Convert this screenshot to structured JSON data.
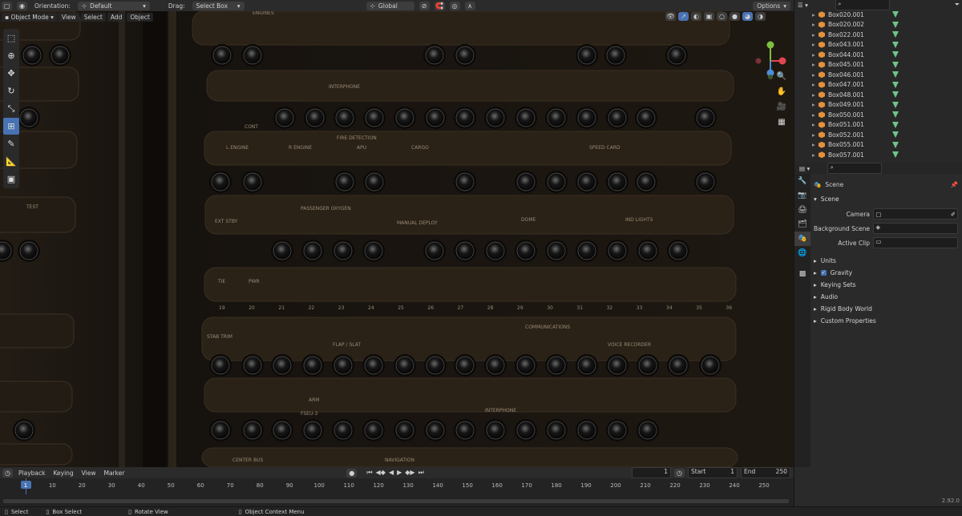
{
  "header": {
    "mode_label": "Object Mode",
    "menus": [
      "View",
      "Select",
      "Add",
      "Object"
    ],
    "orientation_label": "Orientation:",
    "orientation_value": "Default",
    "drag_label": "Drag:",
    "drag_value": "Select Box",
    "transform_value": "Global",
    "options_label": "Options"
  },
  "outliner": {
    "items": [
      "Box020.001",
      "Box020.002",
      "Box022.001",
      "Box043.001",
      "Box044.001",
      "Box045.001",
      "Box046.001",
      "Box047.001",
      "Box048.001",
      "Box049.001",
      "Box050.001",
      "Box051.001",
      "Box052.001",
      "Box055.001",
      "Box057.001"
    ]
  },
  "properties": {
    "title": "Scene",
    "panel_title": "Scene",
    "camera_label": "Camera",
    "background_label": "Background Scene",
    "clip_label": "Active Clip",
    "sections": [
      {
        "label": "Units",
        "checkbox": false
      },
      {
        "label": "Gravity",
        "checkbox": true
      },
      {
        "label": "Keying Sets",
        "checkbox": false
      },
      {
        "label": "Audio",
        "checkbox": false
      },
      {
        "label": "Rigid Body World",
        "checkbox": false
      },
      {
        "label": "Custom Properties",
        "checkbox": false
      }
    ],
    "version": "2.92.0"
  },
  "timeline": {
    "menus": [
      "Playback",
      "Keying",
      "View",
      "Marker"
    ],
    "current_frame": "1",
    "start_label": "Start",
    "start_value": "1",
    "end_label": "End",
    "end_value": "250",
    "frames": [
      "1",
      "10",
      "20",
      "30",
      "40",
      "50",
      "60",
      "70",
      "80",
      "90",
      "100",
      "110",
      "120",
      "130",
      "140",
      "150",
      "160",
      "170",
      "180",
      "190",
      "200",
      "210",
      "220",
      "230",
      "240",
      "250"
    ]
  },
  "status_bar": {
    "select": "Select",
    "box_select": "Box Select",
    "rotate_view": "Rotate View",
    "context_menu": "Object Context Menu"
  },
  "panel_labels": {
    "engines": "ENGINES",
    "interphone": "INTERPHONE",
    "fire_detection": "FIRE DETECTION",
    "engine_l": "L ENGINE",
    "engine_r": "R ENGINE",
    "apu": "APU",
    "cargo": "CARGO",
    "speed_card": "SPEED CARD",
    "passenger_oxygen": "PASSENGER OXYGEN",
    "ext_stby": "EXT STBY",
    "manual_deploy": "MANUAL DEPLOY",
    "dome": "DOME",
    "ind_lights": "IND LIGHTS",
    "stab_trim": "STAB TRIM",
    "flap_slat": "FLAP / SLAT",
    "communications": "COMMUNICATIONS",
    "voice_recorder": "VOICE RECORDER",
    "fseu": "FSEU-3",
    "arm": "ARM",
    "interphone2": "INTERPHONE",
    "navigation": "NAVIGATION",
    "center_bus": "CENTER BUS",
    "cont": "CONT",
    "tie": "TIE",
    "pwr": "PWR",
    "test": "TEST",
    "nums": [
      "19",
      "20",
      "21",
      "22",
      "23",
      "24",
      "25",
      "26",
      "27",
      "28",
      "29",
      "30",
      "31",
      "32",
      "33",
      "34",
      "35",
      "36"
    ]
  },
  "colors": {
    "accent": "#4772b3",
    "panel": "#2a2117",
    "x_axis": "#e0464f",
    "y_axis": "#7fbf3f",
    "z_axis": "#4a8ed8"
  }
}
